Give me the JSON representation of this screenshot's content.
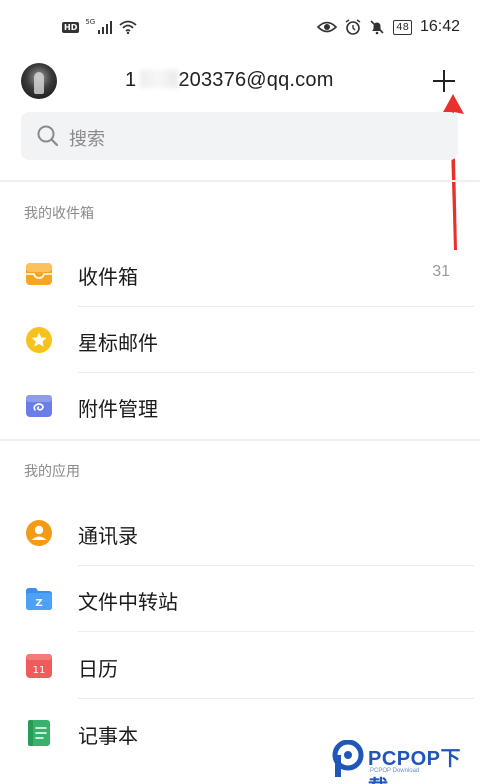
{
  "status_bar": {
    "hd": "HD",
    "network": "5G",
    "battery": "48",
    "time": "16:42"
  },
  "header": {
    "account_prefix": "1",
    "account_suffix": "203376@qq.com"
  },
  "search": {
    "placeholder": "搜索"
  },
  "sections": {
    "mailbox_title": "我的收件箱",
    "apps_title": "我的应用"
  },
  "mailbox_items": [
    {
      "label": "收件箱",
      "count": "31",
      "icon": "inbox-icon",
      "color": "#f5a623"
    },
    {
      "label": "星标邮件",
      "icon": "star-icon",
      "color": "#f8c21c"
    },
    {
      "label": "附件管理",
      "icon": "attachment-icon",
      "color": "#6a7de8"
    }
  ],
  "app_items": [
    {
      "label": "通讯录",
      "icon": "contacts-icon",
      "color": "#f59a14"
    },
    {
      "label": "文件中转站",
      "icon": "folder-icon",
      "color": "#3c8ff0",
      "badge": "Z"
    },
    {
      "label": "日历",
      "icon": "calendar-icon",
      "color": "#f05a5a",
      "badge": "11"
    },
    {
      "label": "记事本",
      "icon": "notepad-icon",
      "color": "#35b36a"
    }
  ],
  "colors": {
    "annotation_arrow": "#e8312a",
    "watermark": "#1f56b8"
  },
  "watermark": {
    "text": "PCPOP下载",
    "sub": "PCPOP Download"
  }
}
